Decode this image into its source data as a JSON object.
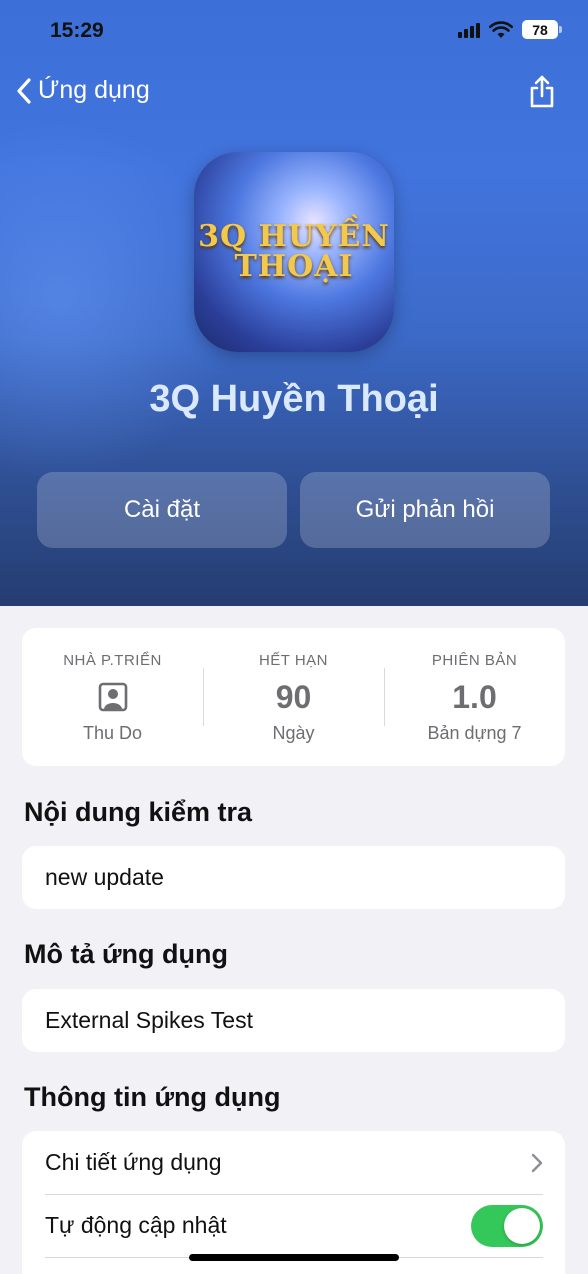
{
  "status_bar": {
    "time": "15:29",
    "battery": "78"
  },
  "nav": {
    "back_label": "Ứng dụng"
  },
  "app": {
    "logo_line1": "3Q HUYỀN",
    "logo_line2": "THOẠI",
    "name": "3Q Huyền Thoại"
  },
  "actions": {
    "install_label": "Cài đặt",
    "feedback_label": "Gửi phản hồi"
  },
  "info": {
    "developer": {
      "label": "NHÀ P.TRIỂN",
      "value": "Thu Do"
    },
    "expires": {
      "label": "HẾT HẠN",
      "value": "90",
      "unit": "Ngày"
    },
    "version": {
      "label": "PHIÊN BẢN",
      "value": "1.0",
      "build": "Bản dựng 7"
    }
  },
  "test_content": {
    "title": "Nội dung kiểm tra",
    "text": "new update"
  },
  "description": {
    "title": "Mô tả ứng dụng",
    "text": "External Spikes Test"
  },
  "app_info": {
    "title": "Thông tin ứng dụng",
    "details_label": "Chi tiết ứng dụng",
    "auto_update_label": "Tự động cập nhật",
    "auto_update_on": true
  },
  "colors": {
    "toggle_on": "#34c759",
    "hero_blue": "#3c6fd8",
    "app_name": "#dbe9ff"
  }
}
